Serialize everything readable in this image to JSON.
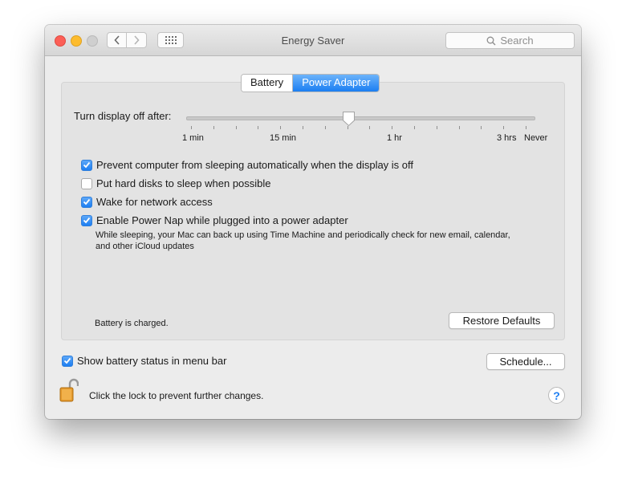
{
  "window": {
    "title": "Energy Saver",
    "search_placeholder": "Search"
  },
  "tabs": [
    {
      "label": "Battery",
      "active": false
    },
    {
      "label": "Power Adapter",
      "active": true
    }
  ],
  "slider": {
    "label": "Turn display off after:",
    "tick_labels": [
      "1 min",
      "15 min",
      "1 hr",
      "3 hrs",
      "Never"
    ],
    "value": "between 15 min and 1 hr"
  },
  "options": [
    {
      "label": "Prevent computer from sleeping automatically when the display is off",
      "checked": true
    },
    {
      "label": "Put hard disks to sleep when possible",
      "checked": false
    },
    {
      "label": "Wake for network access",
      "checked": true
    },
    {
      "label": "Enable Power Nap while plugged into a power adapter",
      "checked": true
    }
  ],
  "power_nap_description": "While sleeping, your Mac can back up using Time Machine and periodically check for new email, calendar, and other iCloud updates",
  "battery_status": "Battery is charged.",
  "restore_defaults_label": "Restore Defaults",
  "show_battery_status": {
    "label": "Show battery status in menu bar",
    "checked": true
  },
  "schedule_label": "Schedule...",
  "lock_text": "Click the lock to prevent further changes.",
  "help_label": "?",
  "colors": {
    "accent": "#1d7ef2",
    "close": "#fc5f57",
    "minimize": "#fdbc2e"
  }
}
